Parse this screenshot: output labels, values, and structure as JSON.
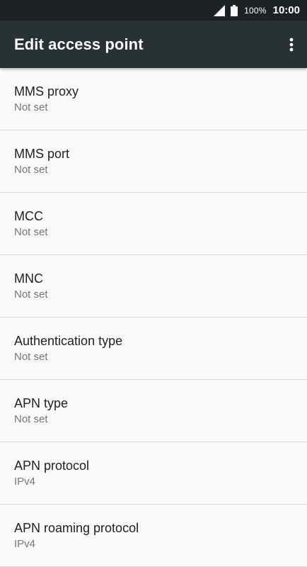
{
  "status_bar": {
    "battery": "100%",
    "time": "10:00",
    "icons": [
      "signal-icon",
      "battery-icon"
    ]
  },
  "app_bar": {
    "title": "Edit access point",
    "menu_icon": "more-vert-icon"
  },
  "settings": [
    {
      "title": "MMS proxy",
      "summary": "Not set"
    },
    {
      "title": "MMS port",
      "summary": "Not set"
    },
    {
      "title": "MCC",
      "summary": "Not set"
    },
    {
      "title": "MNC",
      "summary": "Not set"
    },
    {
      "title": "Authentication type",
      "summary": "Not set"
    },
    {
      "title": "APN type",
      "summary": "Not set"
    },
    {
      "title": "APN protocol",
      "summary": "IPv4"
    },
    {
      "title": "APN roaming protocol",
      "summary": "IPv4"
    }
  ],
  "colors": {
    "status_bar": "#1b2326",
    "app_bar": "#263238",
    "background": "#fafafa",
    "divider": "#d6d6d6"
  }
}
